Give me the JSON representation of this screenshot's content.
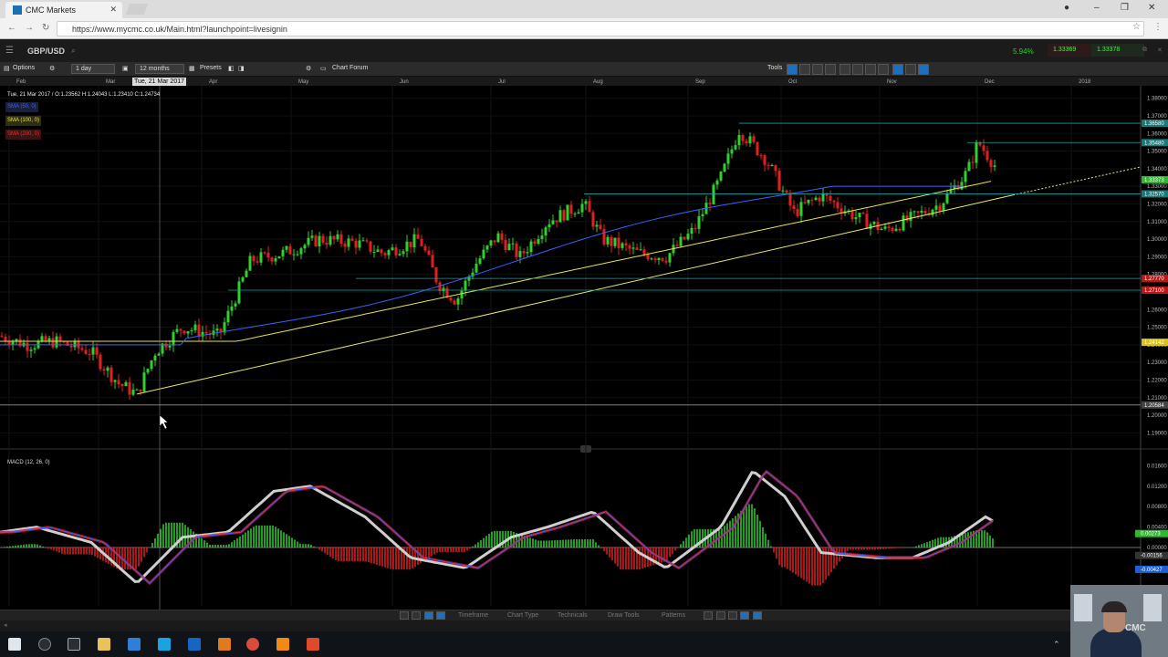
{
  "browser": {
    "tab_title": "CMC Markets",
    "url": "https://www.mycmc.co.uk/Main.html?launchpoint=livesignin"
  },
  "app": {
    "instrument": "GBP/USD",
    "change_pct": "5.94%",
    "sell_price": "1.33369",
    "buy_price": "1.33378"
  },
  "toolbar": {
    "options": "Options",
    "interval": "1 day",
    "range": "12 months",
    "presets": "Presets",
    "chart_forum": "Chart Forum",
    "tools": "Tools"
  },
  "chart": {
    "months": [
      "Feb",
      "Mar",
      "Apr",
      "May",
      "Jun",
      "Jul",
      "Aug",
      "Sep",
      "Oct",
      "Nov",
      "Dec",
      "2018"
    ],
    "crosshair_date": "Tue, 21 Mar 2017",
    "ohlc_readout": "Tue, 21 Mar 2017 / O:1.23562  H:1.24043  L:1.23410  C:1.24734",
    "indicators": [
      {
        "label": "SMA (50, 0)",
        "color": "#3a62ff"
      },
      {
        "label": "SMA (100, 0)",
        "color": "#e3e34a"
      },
      {
        "label": "SMA (200, 0)",
        "color": "#ff2a2a"
      }
    ],
    "price_axis": [
      "1.38000",
      "1.37000",
      "1.36000",
      "1.35000",
      "1.34000",
      "1.33000",
      "1.32000",
      "1.31000",
      "1.30000",
      "1.29000",
      "1.28000",
      "1.27000",
      "1.26000",
      "1.25000",
      "1.24000",
      "1.23000",
      "1.22000",
      "1.21000",
      "1.20000",
      "1.19000"
    ],
    "price_flags": [
      {
        "label": "1.36580",
        "color": "#1a7a7a"
      },
      {
        "label": "1.35480",
        "color": "#1a7a7a"
      },
      {
        "label": "1.33373",
        "color": "#2db82d"
      },
      {
        "label": "1.32570",
        "color": "#1a7a7a"
      },
      {
        "label": "1.27770",
        "color": "#b81818"
      },
      {
        "label": "1.27100",
        "color": "#b81818"
      },
      {
        "label": "1.24142",
        "color": "#d8c418"
      },
      {
        "label": "1.20584",
        "color": "#444444"
      }
    ],
    "macd_label": "MACD (12, 26, 0)",
    "macd_axis": [
      "0.01600",
      "0.01200",
      "0.00800",
      "0.00400",
      "0.00000"
    ],
    "macd_flags": [
      {
        "label": "0.00273",
        "color": "#2db82d"
      },
      {
        "label": "-0.00156",
        "color": "#333333"
      },
      {
        "label": "-0.00427",
        "color": "#1f5fd0"
      }
    ]
  },
  "bottom_bar": [
    "Timeframe",
    "Chart Type",
    "Technicals",
    "Draw Tools",
    "Patterns"
  ]
}
